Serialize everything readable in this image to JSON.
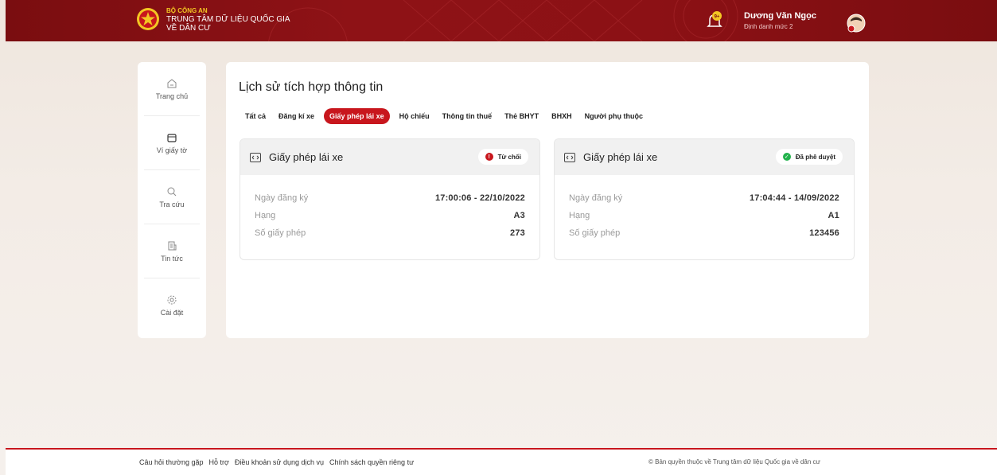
{
  "header": {
    "org_line1": "BỘ CÔNG AN",
    "org_line2": "TRUNG TÂM DỮ LIỆU QUỐC GIA",
    "org_line3": "VỀ DÂN CƯ",
    "notification_badge": "9+",
    "user_name": "Dương Văn Ngọc",
    "user_level": "Định danh mức 2",
    "colors": {
      "primary": "#8e1216",
      "accent": "#f3c623"
    }
  },
  "sidebar": {
    "items": [
      {
        "label": "Trang chủ",
        "icon": "home-icon"
      },
      {
        "label": "Ví giấy tờ",
        "icon": "wallet-icon"
      },
      {
        "label": "Tra cứu",
        "icon": "search-icon"
      },
      {
        "label": "Tin tức",
        "icon": "news-icon"
      },
      {
        "label": "Cài đặt",
        "icon": "gear-icon"
      }
    ]
  },
  "main": {
    "title": "Lịch sử tích hợp thông tin",
    "tabs": [
      {
        "label": "Tất cả"
      },
      {
        "label": "Đăng kí xe"
      },
      {
        "label": "Giấy phép lái xe",
        "active": true
      },
      {
        "label": "Hộ chiếu"
      },
      {
        "label": "Thông tin thuế"
      },
      {
        "label": "Thẻ BHYT"
      },
      {
        "label": "BHXH"
      },
      {
        "label": "Người phụ thuộc"
      }
    ],
    "cards": [
      {
        "title": "Giấy phép lái xe",
        "status": "Từ chối",
        "status_color": "#c8161d",
        "fields": [
          {
            "label": "Ngày đăng ký",
            "value": "17:00:06 - 22/10/2022"
          },
          {
            "label": "Hạng",
            "value": "A3"
          },
          {
            "label": "Số giấy phép",
            "value": "273"
          }
        ]
      },
      {
        "title": "Giấy phép lái xe",
        "status": "Đã phê duyệt",
        "status_color": "#22b24c",
        "fields": [
          {
            "label": "Ngày đăng ký",
            "value": "17:04:44 - 14/09/2022"
          },
          {
            "label": "Hạng",
            "value": "A1"
          },
          {
            "label": "Số giấy phép",
            "value": "123456"
          }
        ]
      }
    ]
  },
  "footer": {
    "links": [
      "Câu hỏi thường gặp",
      "Hỗ trợ",
      "Điều khoản sử dụng dịch vụ",
      "Chính sách quyền riêng tư"
    ],
    "copyright": "© Bản quyền thuộc về Trung tâm dữ liệu Quốc gia về dân cư"
  }
}
